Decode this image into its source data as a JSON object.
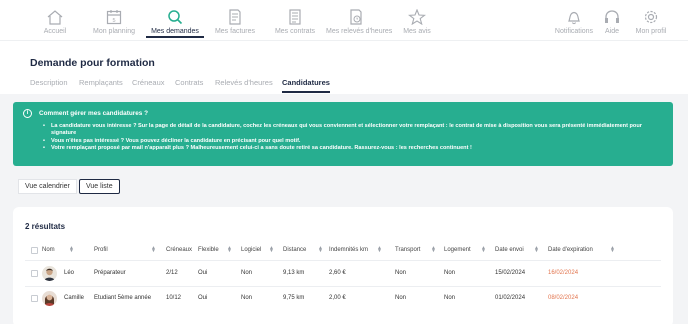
{
  "nav": {
    "items": [
      {
        "label": "Accueil",
        "icon": "home-icon"
      },
      {
        "label": "Mon planning",
        "icon": "calendar-icon"
      },
      {
        "label": "Mes demandes",
        "icon": "search-icon"
      },
      {
        "label": "Mes factures",
        "icon": "invoice-icon"
      },
      {
        "label": "Mes contrats",
        "icon": "contract-icon"
      },
      {
        "label": "Mes relevés d'heures",
        "icon": "timesheet-icon"
      },
      {
        "label": "Mes avis",
        "icon": "star-icon"
      },
      {
        "label": "Notifications",
        "icon": "bell-icon"
      },
      {
        "label": "Aide",
        "icon": "headset-icon"
      },
      {
        "label": "Mon profil",
        "icon": "gear-icon"
      }
    ],
    "active_color": "#1f2a44",
    "inactive_color": "#a9acb2"
  },
  "page": {
    "title": "Demande pour formation",
    "tabs": [
      {
        "label": "Description"
      },
      {
        "label": "Remplaçants"
      },
      {
        "label": "Créneaux"
      },
      {
        "label": "Contrats"
      },
      {
        "label": "Relevés d'heures"
      },
      {
        "label": "Candidatures"
      }
    ]
  },
  "banner": {
    "icon": "info-icon",
    "title": "Comment gérer mes candidatures ?",
    "items": [
      "La candidature vous intéresse ? Sur la page de détail de la candidature, cochez les créneaux qui vous conviennent et sélectionner votre remplaçant : le contrat de mise à disposition vous sera présenté immédiatement pour signature",
      "Vous n'êtes pas intéressé ? Vous pouvez décliner la candidature en précisant pour quel motif.",
      "Votre remplaçant proposé par mail n'apparaît plus ? Malheureusement celui-ci a sans doute retiré sa candidature. Rassurez-vous : les recherches continuent !"
    ],
    "color": "#27ae90"
  },
  "view_toggle": {
    "calendar_label": "Vue calendrier",
    "list_label": "Vue liste"
  },
  "results": {
    "title": "2 résultats",
    "columns": [
      "Nom",
      "Profil",
      "Créneaux",
      "Flexible",
      "Logiciel",
      "Distance",
      "Indemnités km",
      "Transport",
      "Logement",
      "Date envoi",
      "Date d'expiration"
    ],
    "rows": [
      [
        "Léo",
        "Préparateur",
        "2/12",
        "Oui",
        "Non",
        "9,13 km",
        "2,60 €",
        "Non",
        "Non",
        "15/02/2024",
        "16/02/2024"
      ],
      [
        "Camille",
        "Etudiant 5ème année",
        "10/12",
        "Oui",
        "Non",
        "9,75 km",
        "2,00 €",
        "Non",
        "Non",
        "01/02/2024",
        "08/02/2024"
      ]
    ],
    "expiry_warning_color": "#e2744d"
  }
}
